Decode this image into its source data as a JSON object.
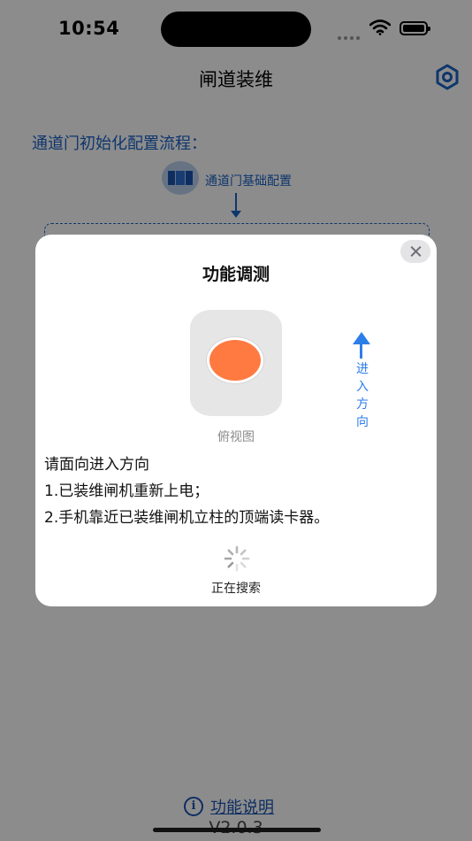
{
  "status_bar": {
    "time": "10:54"
  },
  "navbar": {
    "title": "闸道装维",
    "settings_icon": "hexagon-gear-icon"
  },
  "main": {
    "section_title": "通道门初始化配置流程：",
    "step_label": "通道门基础配置",
    "help_label": "功能说明",
    "version": "V2.0.3"
  },
  "modal": {
    "title": "功能调测",
    "view_label": "俯视图",
    "direction_text": [
      "进",
      "入",
      "方",
      "向"
    ],
    "instructions": [
      "请面向进入方向",
      "1.已装维闸机重新上电；",
      "2.手机靠近已装维闸机立柱的顶端读卡器。"
    ],
    "status_text": "正在搜索"
  },
  "colors": {
    "accent": "#1a63c7",
    "direction_arrow": "#2b7de9",
    "reader_dot": "#ff7a40",
    "overlay": "rgba(0,0,0,0.45)"
  }
}
